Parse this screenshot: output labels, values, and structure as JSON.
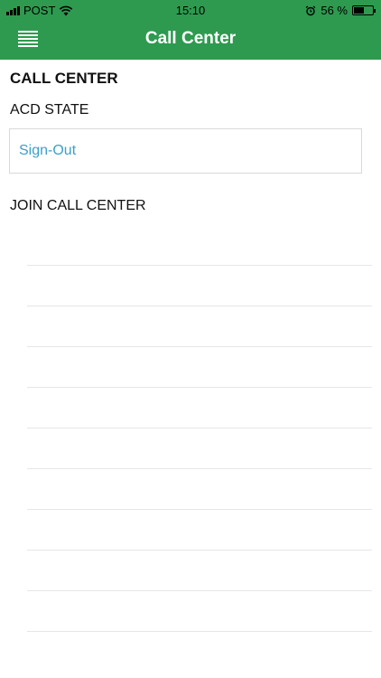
{
  "status_bar": {
    "carrier": "POST",
    "time": "15:10",
    "battery": "56 %",
    "battery_level": 0.56
  },
  "header": {
    "title": "Call Center"
  },
  "main": {
    "section_title": "CALL CENTER",
    "acd_label": "ACD STATE",
    "acd_value": "Sign-Out",
    "join_label": "JOIN CALL CENTER",
    "join_rows": [
      "",
      "",
      "",
      "",
      "",
      "",
      "",
      "",
      "",
      ""
    ]
  },
  "colors": {
    "accent": "#2e9a4f",
    "link": "#3ba0cc"
  }
}
